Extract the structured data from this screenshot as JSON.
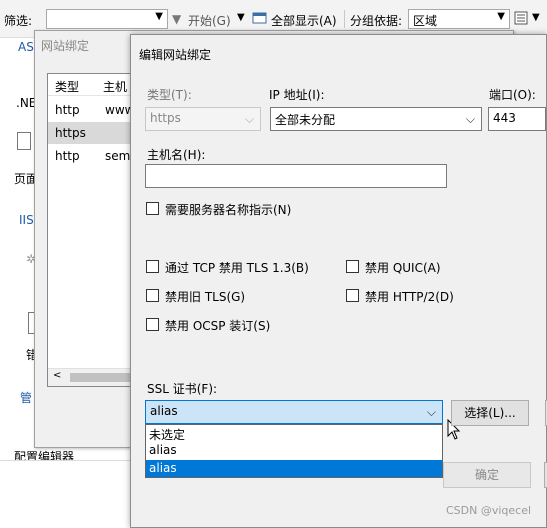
{
  "toolbar": {
    "filter_label": "筛选:",
    "start_label": "开始(G)",
    "show_all_label": "全部显示(A)",
    "group_by_label": "分组依据:",
    "group_by_value": "区域"
  },
  "background": {
    "asp_label": "AS",
    "net_label": ".NE",
    "page_label": "页面",
    "iis_label": "IIS",
    "manage_label": "管",
    "config_editor_label": "配置编辑器",
    "short_label": "错"
  },
  "bindings_window": {
    "title": "网站绑定",
    "columns": [
      "类型",
      "主机"
    ],
    "rows": [
      {
        "type": "http",
        "host": "www"
      },
      {
        "type": "https",
        "host": ""
      },
      {
        "type": "http",
        "host": "semi"
      }
    ]
  },
  "edit_dialog": {
    "title": "编辑网站绑定",
    "type_label": "类型(T):",
    "type_value": "https",
    "ip_label": "IP 地址(I):",
    "ip_value": "全部未分配",
    "port_label": "端口(O):",
    "port_value": "443",
    "hostname_label": "主机名(H):",
    "hostname_value": "",
    "sni_label": "需要服务器名称指示(N)",
    "tcp_tls13_label": "通过 TCP 禁用 TLS 1.3(B)",
    "quic_label": "禁用 QUIC(A)",
    "old_tls_label": "禁用旧 TLS(G)",
    "http2_label": "禁用 HTTP/2(D)",
    "ocsp_label": "禁用 OCSP 装订(S)",
    "ssl_label": "SSL 证书(F):",
    "ssl_value": "alias",
    "ssl_options": [
      "未选定",
      "alias",
      "alias"
    ],
    "select_button": "选择(L)...",
    "ok_button": "确定"
  },
  "watermark": "CSDN @viqecel",
  "colors": {
    "selection": "#0078d7",
    "combo_focus": "#cce4f7",
    "link_blue": "#1e5aa8"
  }
}
